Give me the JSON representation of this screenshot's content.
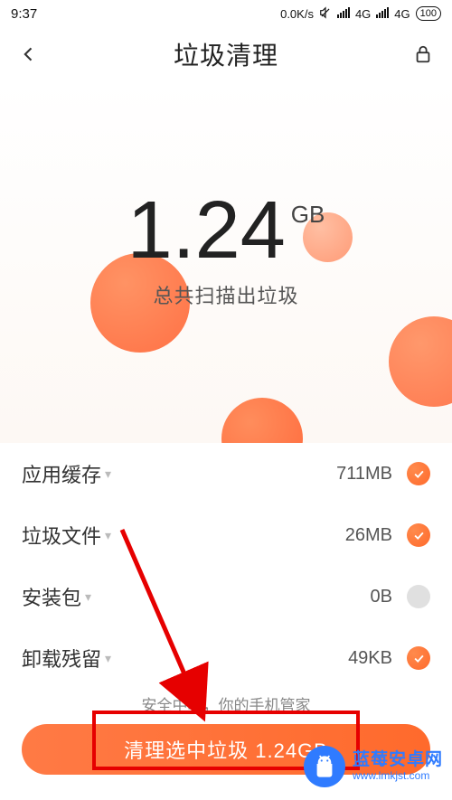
{
  "status": {
    "time": "9:37",
    "net_speed": "0.0K/s",
    "signal1": "4G",
    "signal2": "4G",
    "battery": "100"
  },
  "header": {
    "title": "垃圾清理"
  },
  "hero": {
    "value": "1.24",
    "unit": "GB",
    "subtitle": "总共扫描出垃圾"
  },
  "rows": [
    {
      "label": "应用缓存",
      "size": "711MB",
      "checked": true
    },
    {
      "label": "垃圾文件",
      "size": "26MB",
      "checked": true
    },
    {
      "label": "安装包",
      "size": "0B",
      "checked": false
    },
    {
      "label": "卸载残留",
      "size": "49KB",
      "checked": true
    }
  ],
  "hint": "安全中心，你的手机管家",
  "cta_label": "清理选中垃圾 1.24GB",
  "watermark": {
    "title": "蓝莓安卓网",
    "url": "www.lmkjst.com"
  }
}
